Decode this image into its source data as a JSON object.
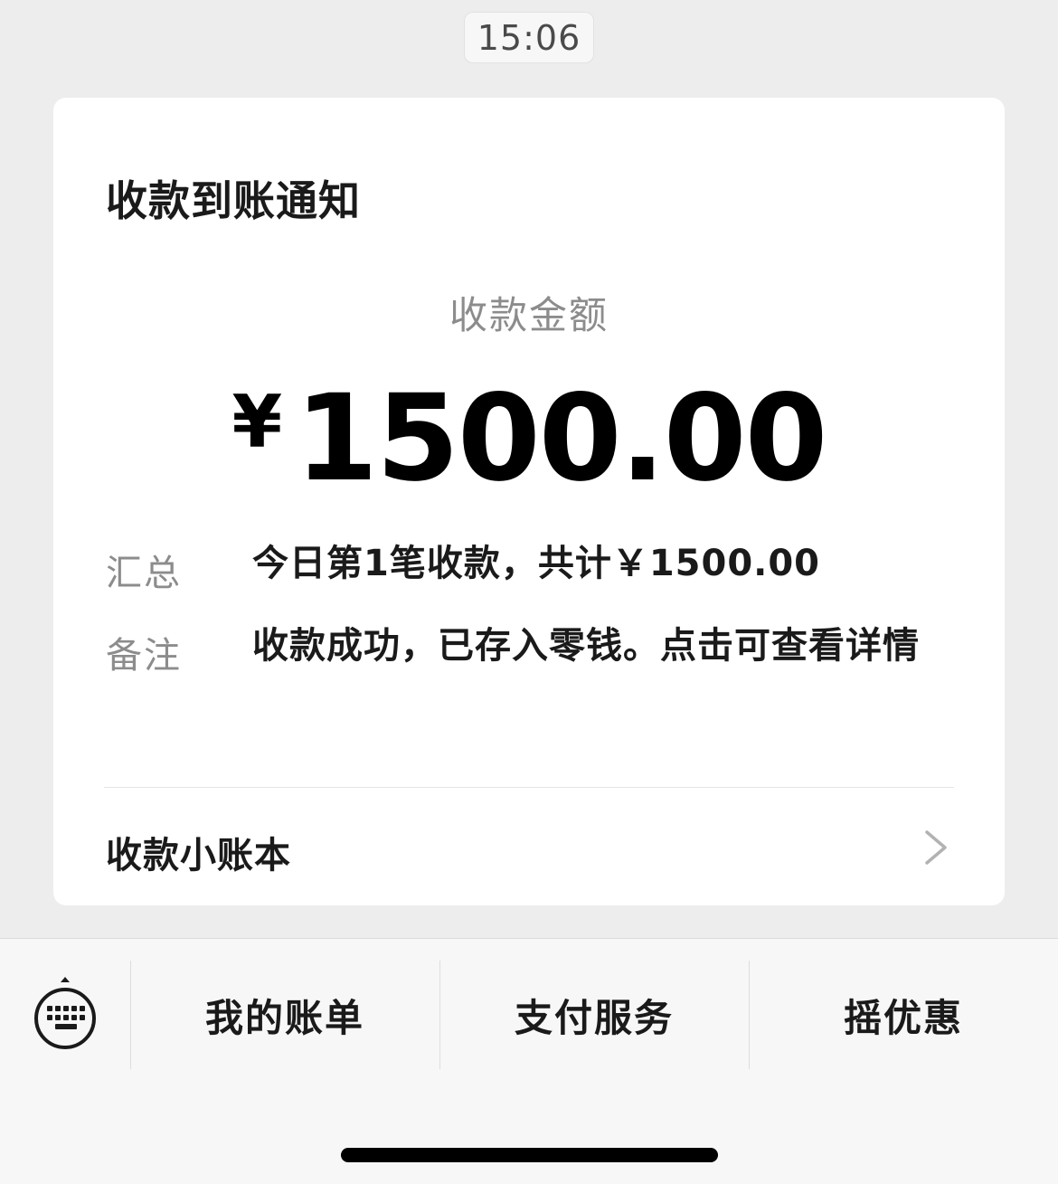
{
  "chat": {
    "timestamp": "15:06"
  },
  "card": {
    "title": "收款到账通知",
    "amount_label": "收款金额",
    "currency_symbol": "¥",
    "amount": "1500.00",
    "summary_label": "汇总",
    "summary_value": "今日第1笔收款，共计￥1500.00",
    "remark_label": "备注",
    "remark_value": "收款成功，已存入零钱。点击可查看详情",
    "ledger_link": "收款小账本",
    "ledger_icon": "chevron-right-icon"
  },
  "bottom_menu": {
    "keyboard_icon": "keyboard-icon",
    "items": [
      {
        "label": "我的账单"
      },
      {
        "label": "支付服务"
      },
      {
        "label": "摇优惠"
      }
    ]
  }
}
